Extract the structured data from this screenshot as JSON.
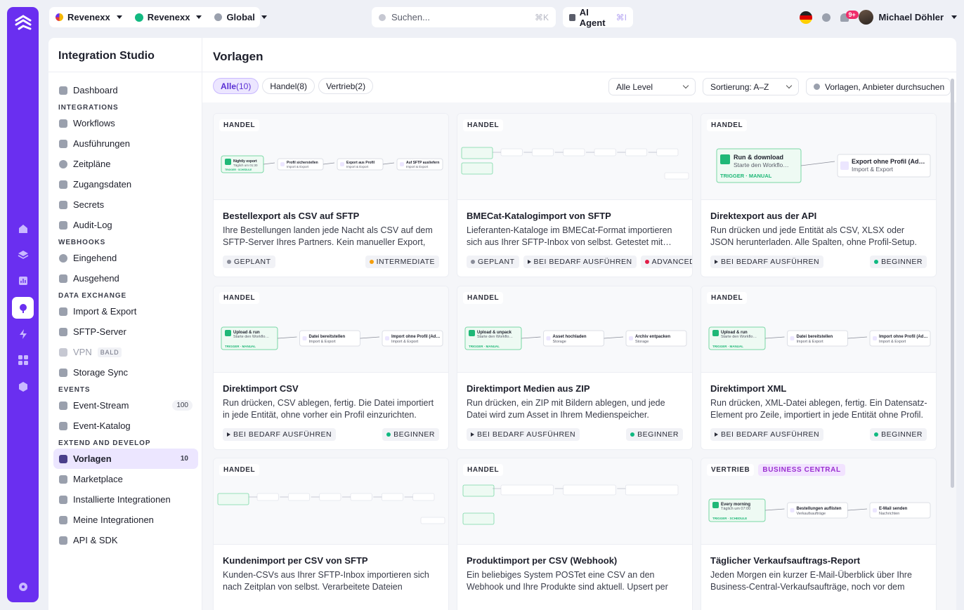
{
  "topbar": {
    "org1": "Revenexx",
    "org2": "Revenexx",
    "region": "Global",
    "search_placeholder": "Suchen...",
    "search_kbd": "⌘K",
    "agent_label": "AI Agent",
    "agent_kbd": "⌘I",
    "notification_badge": "9+",
    "user_name": "Michael Döhler"
  },
  "sidebar": {
    "title": "Integration Studio",
    "dashboard": "Dashboard",
    "sections": {
      "integrations": "INTEGRATIONS",
      "webhooks": "WEBHOOKS",
      "data_exchange": "DATA EXCHANGE",
      "events": "EVENTS",
      "extend": "EXTEND AND DEVELOP"
    },
    "items": {
      "workflows": "Workflows",
      "ausfuehrungen": "Ausführungen",
      "zeitplaene": "Zeitpläne",
      "zugangsdaten": "Zugangsdaten",
      "secrets": "Secrets",
      "auditlog": "Audit-Log",
      "eingehend": "Eingehend",
      "ausgehend": "Ausgehend",
      "importexport": "Import & Export",
      "sftp": "SFTP-Server",
      "vpn": "VPN",
      "vpn_badge": "BALD",
      "storage": "Storage Sync",
      "eventstream": "Event-Stream",
      "eventstream_count": "100",
      "eventkatalog": "Event-Katalog",
      "vorlagen": "Vorlagen",
      "vorlagen_count": "10",
      "marketplace": "Marketplace",
      "installiert": "Installierte Integrationen",
      "meine": "Meine Integrationen",
      "api": "API & SDK"
    }
  },
  "content": {
    "title": "Vorlagen",
    "tabs": [
      {
        "label": "Alle",
        "count": "(10)"
      },
      {
        "label": "Handel",
        "count": "(8)"
      },
      {
        "label": "Vertrieb",
        "count": "(2)"
      }
    ],
    "level_select": "Alle Level",
    "sort_select": "Sortierung: A–Z",
    "search_placeholder": "Vorlagen, Anbieter durchsuchen"
  },
  "cards": [
    {
      "tags": [
        "HANDEL"
      ],
      "title": "Bestellexport als CSV auf SFTP",
      "desc": "Ihre Bestellungen landen jede Nacht als CSV auf dem SFTP-Server Ihres Partners. Kein manueller Export, kein…",
      "chips": [
        {
          "label": "GEPLANT",
          "kind": "dot",
          "color": "#8a8d99"
        }
      ],
      "level": {
        "label": "INTERMEDIATE",
        "color": "#f59e0b"
      },
      "flow": {
        "trigger": "Nightly export",
        "trigger_sub": "Täglich um 01:30",
        "trigger_tag": "TRIGGER · SCHEDULE",
        "steps": [
          [
            "Profil sicherstellen",
            "Import & Export"
          ],
          [
            "Export aus Profil",
            "Import & Export"
          ],
          [
            "Auf SFTP ausliefern",
            "Import & Export"
          ]
        ]
      }
    },
    {
      "tags": [
        "HANDEL"
      ],
      "title": "BMECat-Katalogimport von SFTP",
      "desc": "Lieferanten-Kataloge im BMECat-Format importieren sich aus Ihrer SFTP-Inbox von selbst. Getestet mit…",
      "chips": [
        {
          "label": "GEPLANT",
          "kind": "dot",
          "color": "#8a8d99"
        },
        {
          "label": "BEI BEDARF AUSFÜHREN",
          "kind": "tri"
        }
      ],
      "level": {
        "label": "ADVANCED",
        "color": "#e11d48"
      }
    },
    {
      "tags": [
        "HANDEL"
      ],
      "title": "Direktexport aus der API",
      "desc": "Run drücken und jede Entität als CSV, XLSX oder JSON herunterladen. Alle Spalten, ohne Profil-Setup.",
      "chips": [
        {
          "label": "BEI BEDARF AUSFÜHREN",
          "kind": "tri"
        }
      ],
      "level": {
        "label": "BEGINNER",
        "color": "#10b981"
      },
      "flow": {
        "trigger": "Run & download",
        "trigger_sub": "Starte den Workflo…",
        "trigger_tag": "TRIGGER · MANUAL",
        "steps": [
          [
            "Export ohne Profil (Ad…",
            "Import & Export"
          ]
        ]
      }
    },
    {
      "tags": [
        "HANDEL"
      ],
      "title": "Direktimport CSV",
      "desc": "Run drücken, CSV ablegen, fertig. Die Datei importiert in jede Entität, ohne vorher ein Profil einzurichten.",
      "chips": [
        {
          "label": "BEI BEDARF AUSFÜHREN",
          "kind": "tri"
        }
      ],
      "level": {
        "label": "BEGINNER",
        "color": "#10b981"
      },
      "flow": {
        "trigger": "Upload & run",
        "trigger_sub": "Starte den Workflo…",
        "trigger_tag": "TRIGGER · MANUAL",
        "steps": [
          [
            "Datei bereitstellen",
            "Import & Export"
          ],
          [
            "Import ohne Profil (Ad…",
            "Import & Export"
          ]
        ]
      }
    },
    {
      "tags": [
        "HANDEL"
      ],
      "title": "Direktimport Medien aus ZIP",
      "desc": "Run drücken, ein ZIP mit Bildern ablegen, und jede Datei wird zum Asset in Ihrem Medienspeicher.",
      "chips": [
        {
          "label": "BEI BEDARF AUSFÜHREN",
          "kind": "tri"
        }
      ],
      "level": {
        "label": "BEGINNER",
        "color": "#10b981"
      },
      "flow": {
        "trigger": "Upload & unpack",
        "trigger_sub": "Starte den Workflo…",
        "trigger_tag": "TRIGGER · MANUAL",
        "steps": [
          [
            "Asset hochladen",
            "Storage"
          ],
          [
            "Archiv entpacken",
            "Storage"
          ]
        ]
      }
    },
    {
      "tags": [
        "HANDEL"
      ],
      "title": "Direktimport XML",
      "desc": "Run drücken, XML-Datei ablegen, fertig. Ein Datensatz-Element pro Zeile, importiert in jede Entität ohne Profil.",
      "chips": [
        {
          "label": "BEI BEDARF AUSFÜHREN",
          "kind": "tri"
        }
      ],
      "level": {
        "label": "BEGINNER",
        "color": "#10b981"
      },
      "flow": {
        "trigger": "Upload & run",
        "trigger_sub": "Starte den Workflo…",
        "trigger_tag": "TRIGGER · MANUAL",
        "steps": [
          [
            "Datei bereitstellen",
            "Import & Export"
          ],
          [
            "Import ohne Profil (Ad…",
            "Import & Export"
          ]
        ]
      }
    },
    {
      "tags": [
        "HANDEL"
      ],
      "title": "Kundenimport per CSV von SFTP",
      "desc": "Kunden-CSVs aus Ihrer SFTP-Inbox importieren sich nach Zeitplan von selbst. Verarbeitete Dateien wandern…",
      "chips": [],
      "level": null
    },
    {
      "tags": [
        "HANDEL"
      ],
      "title": "Produktimport per CSV (Webhook)",
      "desc": "Ein beliebiges System POSTet eine CSV an den Webhook und Ihre Produkte sind aktuell. Upsert per SKU, mit…",
      "chips": [],
      "level": null
    },
    {
      "tags": [
        "VERTRIEB",
        "BUSINESS CENTRAL"
      ],
      "title": "Täglicher Verkaufsauftrags-Report",
      "desc": "Jeden Morgen ein kurzer E-Mail-Überblick über Ihre Business-Central-Verkaufsaufträge, noch vor dem erste…",
      "chips": [],
      "level": null,
      "flow": {
        "trigger": "Every morning",
        "trigger_sub": "Täglich um 07:00",
        "trigger_tag": "TRIGGER · SCHEDULE",
        "steps": [
          [
            "Bestellungen auflisten",
            "Verkaufsaufträge"
          ],
          [
            "E-Mail senden",
            "Nachrichten"
          ]
        ]
      }
    }
  ],
  "colors": {
    "accent": "#6a2ff0",
    "trigger_green": "#1fb877"
  }
}
